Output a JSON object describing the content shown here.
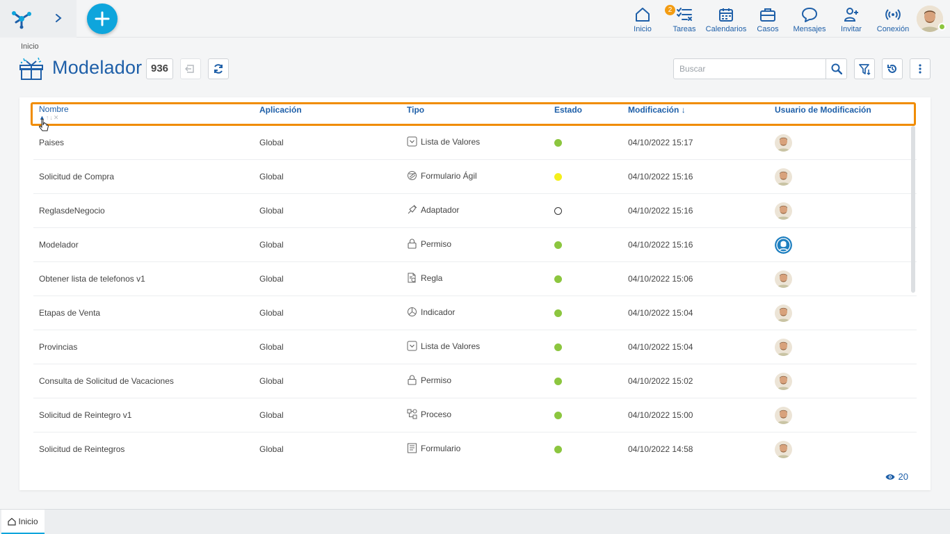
{
  "nav": {
    "items": [
      {
        "label": "Inicio",
        "icon": "home-icon"
      },
      {
        "label": "Tareas",
        "icon": "tasks-icon",
        "badge": "2"
      },
      {
        "label": "Calendarios",
        "icon": "calendar-icon"
      },
      {
        "label": "Casos",
        "icon": "briefcase-icon"
      },
      {
        "label": "Mensajes",
        "icon": "chat-icon"
      },
      {
        "label": "Invitar",
        "icon": "invite-user-icon"
      },
      {
        "label": "Conexión",
        "icon": "connection-icon"
      }
    ]
  },
  "breadcrumb": "Inicio",
  "page": {
    "title": "Modelador",
    "count": "936"
  },
  "search": {
    "placeholder": "Buscar"
  },
  "table": {
    "columns": {
      "nombre": "Nombre",
      "aplicacion": "Aplicación",
      "tipo": "Tipo",
      "estado": "Estado",
      "modificacion": "Modificación",
      "usuario": "Usuario de Modificación"
    },
    "sort_indicator": "↓",
    "rows": [
      {
        "nombre": "Paises",
        "aplicacion": "Global",
        "tipo": "Lista de Valores",
        "tipo_icon": "list-values-icon",
        "estado": "green",
        "modificacion": "04/10/2022 15:17",
        "usuario": "photo"
      },
      {
        "nombre": "Solicitud de Compra",
        "aplicacion": "Global",
        "tipo": "Formulario Ágil",
        "tipo_icon": "agile-form-icon",
        "estado": "yellow",
        "modificacion": "04/10/2022 15:16",
        "usuario": "photo"
      },
      {
        "nombre": "ReglasdeNegocio",
        "aplicacion": "Global",
        "tipo": "Adaptador",
        "tipo_icon": "adapter-icon",
        "estado": "empty",
        "modificacion": "04/10/2022 15:16",
        "usuario": "photo"
      },
      {
        "nombre": "Modelador",
        "aplicacion": "Global",
        "tipo": "Permiso",
        "tipo_icon": "lock-icon",
        "estado": "green",
        "modificacion": "04/10/2022 15:16",
        "usuario": "generic"
      },
      {
        "nombre": "Obtener lista de telefonos v1",
        "aplicacion": "Global",
        "tipo": "Regla",
        "tipo_icon": "rule-icon",
        "estado": "green",
        "modificacion": "04/10/2022 15:06",
        "usuario": "photo"
      },
      {
        "nombre": "Etapas de Venta",
        "aplicacion": "Global",
        "tipo": "Indicador",
        "tipo_icon": "indicator-icon",
        "estado": "green",
        "modificacion": "04/10/2022 15:04",
        "usuario": "photo"
      },
      {
        "nombre": "Provincias",
        "aplicacion": "Global",
        "tipo": "Lista de Valores",
        "tipo_icon": "list-values-icon",
        "estado": "green",
        "modificacion": "04/10/2022 15:04",
        "usuario": "photo"
      },
      {
        "nombre": "Consulta de Solicitud de Vacaciones",
        "aplicacion": "Global",
        "tipo": "Permiso",
        "tipo_icon": "lock-icon",
        "estado": "green",
        "modificacion": "04/10/2022 15:02",
        "usuario": "photo"
      },
      {
        "nombre": "Solicitud de Reintegro v1",
        "aplicacion": "Global",
        "tipo": "Proceso",
        "tipo_icon": "process-icon",
        "estado": "green",
        "modificacion": "04/10/2022 15:00",
        "usuario": "photo"
      },
      {
        "nombre": "Solicitud de Reintegros",
        "aplicacion": "Global",
        "tipo": "Formulario",
        "tipo_icon": "form-icon",
        "estado": "green",
        "modificacion": "04/10/2022 14:58",
        "usuario": "photo"
      }
    ]
  },
  "footer": {
    "visible_count": "20"
  },
  "tabs": [
    {
      "label": "Inicio"
    }
  ],
  "colors": {
    "accent": "#1e5fa8",
    "highlight": "#f08c00",
    "status_green": "#8cc63f",
    "status_yellow": "#f4ef1c",
    "fab": "#0ea5dc"
  }
}
